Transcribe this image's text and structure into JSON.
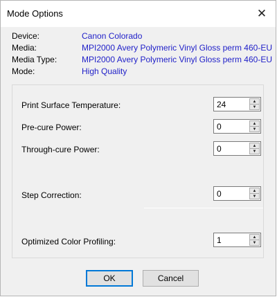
{
  "window": {
    "title": "Mode Options",
    "close_glyph": "✕"
  },
  "info": [
    {
      "label": "Device:",
      "value": "Canon Colorado"
    },
    {
      "label": "Media:",
      "value": "MPI2000 Avery Polymeric Vinyl Gloss perm 460-EU"
    },
    {
      "label": "Media Type:",
      "value": "MPI2000 Avery Polymeric Vinyl Gloss perm 460-EU"
    },
    {
      "label": "Mode:",
      "value": "High Quality"
    }
  ],
  "fields": [
    {
      "label": "Print Surface Temperature:",
      "value": "24"
    },
    {
      "label": "Pre-cure Power:",
      "value": "0"
    },
    {
      "label": "Through-cure Power:",
      "value": "0"
    },
    {
      "label": "Step Correction:",
      "value": "0"
    },
    {
      "label": "Optimized Color Profiling:",
      "value": "1"
    }
  ],
  "buttons": {
    "ok": "OK",
    "cancel": "Cancel"
  },
  "colors": {
    "value_text": "#1e1ec8",
    "focus_border": "#0078d7"
  }
}
